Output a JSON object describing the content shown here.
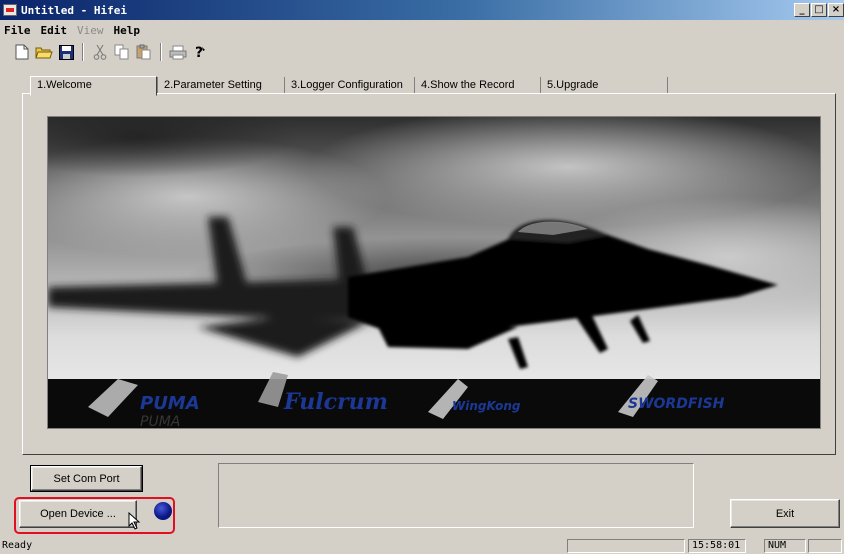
{
  "window": {
    "title": "Untitled - Hifei",
    "controls": [
      "_",
      "□",
      "×"
    ]
  },
  "menu": {
    "items": [
      {
        "label": "File",
        "enabled": true
      },
      {
        "label": "Edit",
        "enabled": true
      },
      {
        "label": "View",
        "enabled": false
      },
      {
        "label": "Help",
        "enabled": true
      }
    ]
  },
  "toolbar": {
    "icons": [
      "new-file-icon",
      "open-folder-icon",
      "save-icon",
      "cut-icon",
      "copy-icon",
      "paste-icon",
      "print-icon",
      "help-icon"
    ]
  },
  "tabs": [
    {
      "label": "1.Welcome",
      "active": true
    },
    {
      "label": "2.Parameter Setting",
      "active": false
    },
    {
      "label": "3.Logger Configuration",
      "active": false
    },
    {
      "label": "4.Show the Record",
      "active": false
    },
    {
      "label": "5.Upgrade",
      "active": false
    }
  ],
  "banner": {
    "logos": [
      "PUMA",
      "Fulcrum",
      "WingKong",
      "SWORDFISH"
    ]
  },
  "buttons": {
    "set_com_port": "Set Com Port",
    "open_device": "Open Device ...",
    "exit": "Exit"
  },
  "status": {
    "text": "Ready",
    "time": "15:58:01",
    "indicator": "NUM"
  },
  "colors": {
    "highlight": "#e01020",
    "led": "#0b1a8a",
    "titlebar": "#0a246a"
  }
}
